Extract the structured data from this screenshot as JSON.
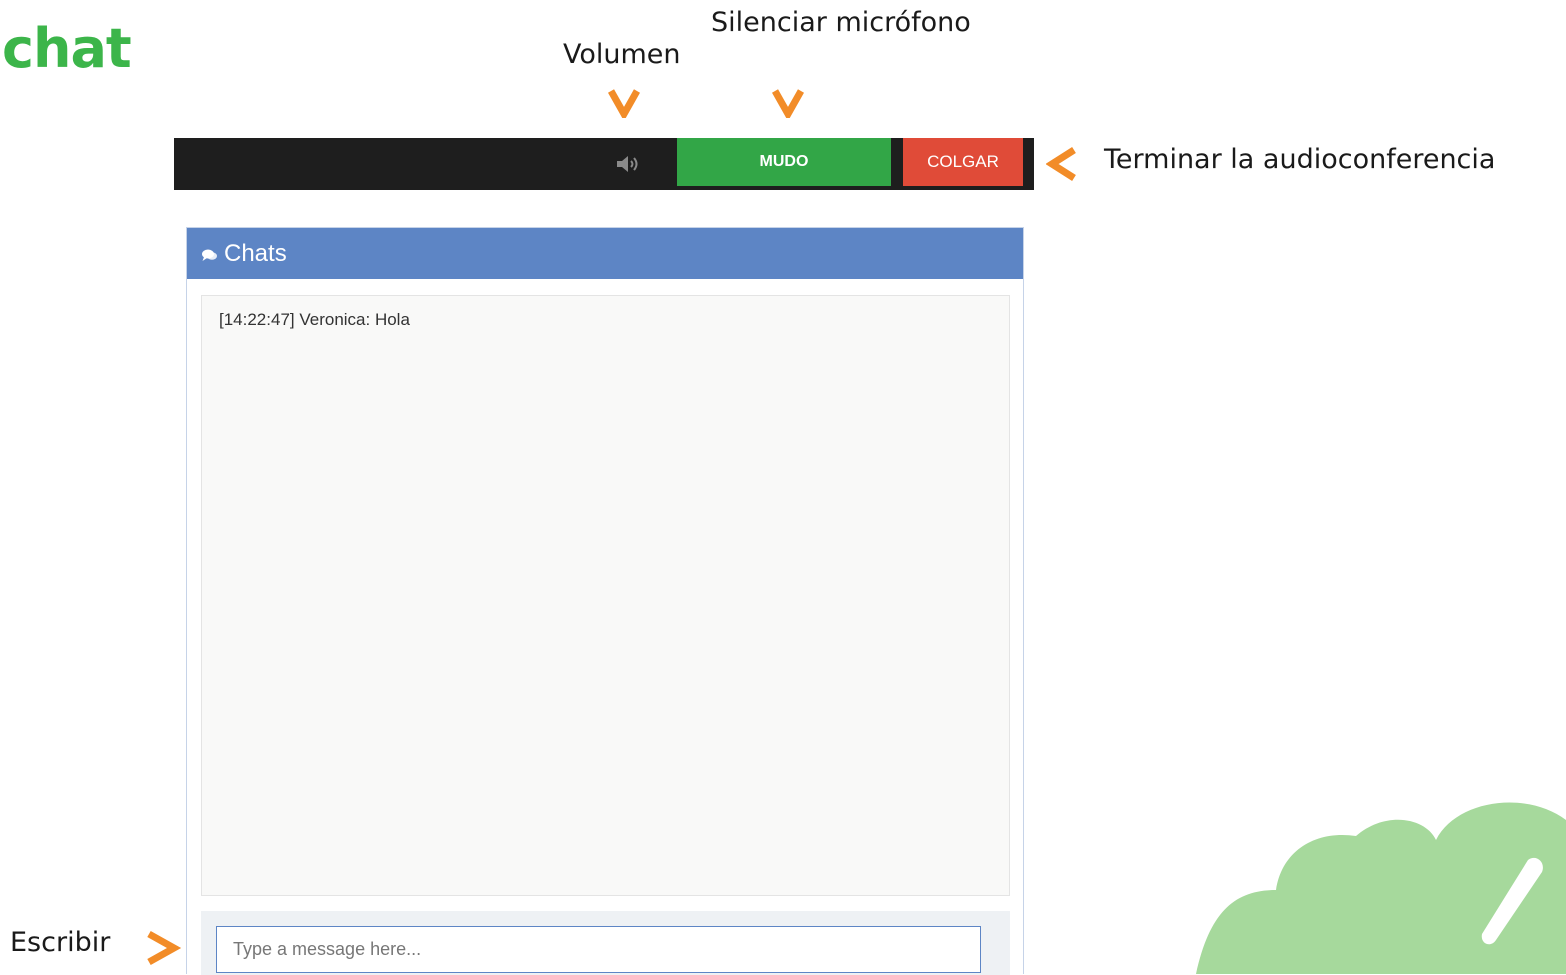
{
  "heading": "chat",
  "annotations": {
    "volume": "Volumen",
    "mute": "Silenciar micrófono",
    "hangup": "Terminar la audioconferencia",
    "write": "Escribir"
  },
  "callbar": {
    "volume_icon": "speaker-icon",
    "mute_label": "MUDO",
    "hangup_label": "COLGAR"
  },
  "chat_panel": {
    "title": "Chats",
    "icon": "chat-bubbles-icon",
    "messages": [
      {
        "text": "[14:22:47] Veronica: Hola"
      }
    ],
    "input_placeholder": "Type a message here..."
  },
  "colors": {
    "brand_green": "#3cb54a",
    "arrow_orange": "#f28c28",
    "mute_green": "#32a647",
    "hangup_red": "#e04b38",
    "panel_blue": "#5d85c5",
    "decor_green": "#a6d99c"
  }
}
